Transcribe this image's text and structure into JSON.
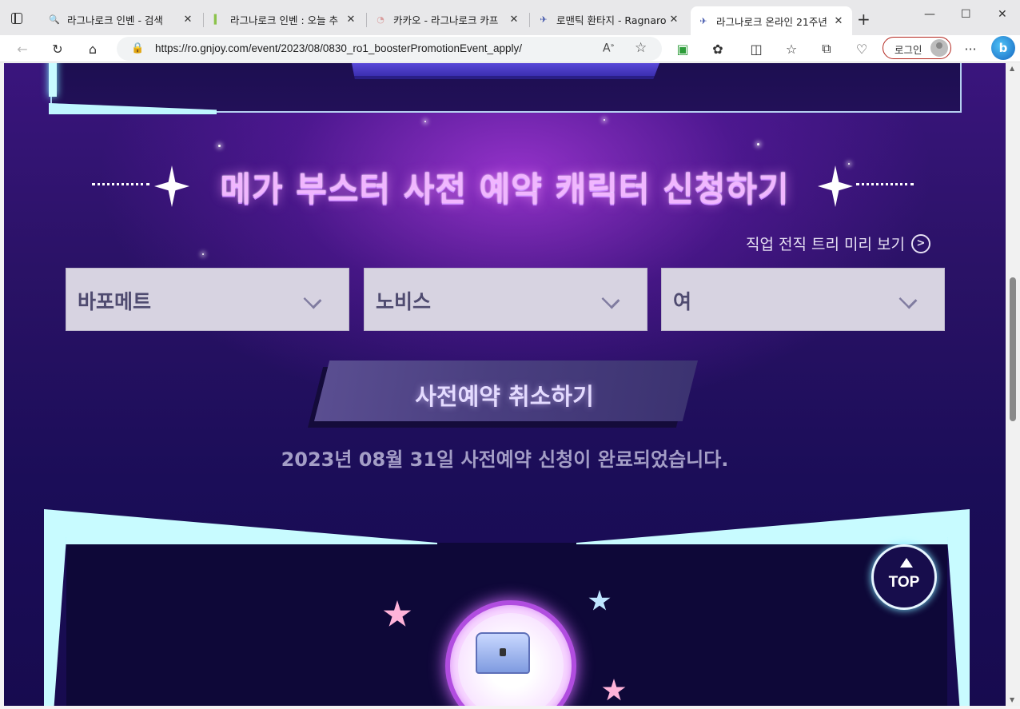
{
  "browser": {
    "tabs": [
      {
        "title": "라그나로크 인벤 - 검색",
        "favicon": "search-icon"
      },
      {
        "title": "라그나로크 인벤 : 오늘 추",
        "favicon": "inven-icon"
      },
      {
        "title": "카카오 - 라그나로크 카프",
        "favicon": "kakao-icon"
      },
      {
        "title": "로맨틱 환타지 - Ragnarok",
        "favicon": "ragnarok-icon"
      },
      {
        "title": "라그나로크 온라인 21주년",
        "favicon": "ragnarok-icon",
        "active": true
      }
    ],
    "url": "https://ro.gnjoy.com/event/2023/08/0830_ro1_boosterPromotionEvent_apply/",
    "login_label": "로그인",
    "bing_label": "b"
  },
  "page": {
    "heading": "메가 부스터 사전 예약 캐릭터 신청하기",
    "tree_link": "직업 전직 트리 미리 보기",
    "selects": [
      {
        "value": "바포메트"
      },
      {
        "value": "노비스"
      },
      {
        "value": "여"
      }
    ],
    "cancel_button": "사전예약 취소하기",
    "done_message": "2023년 08월 31일 사전예약 신청이 완료되었습니다.",
    "top_button": "TOP"
  },
  "colors": {
    "accent_glow": "#c8fbff",
    "heading_pink": "#f1b6ff",
    "select_bg": "#d7d3e1",
    "page_bg": "#2a1266"
  }
}
